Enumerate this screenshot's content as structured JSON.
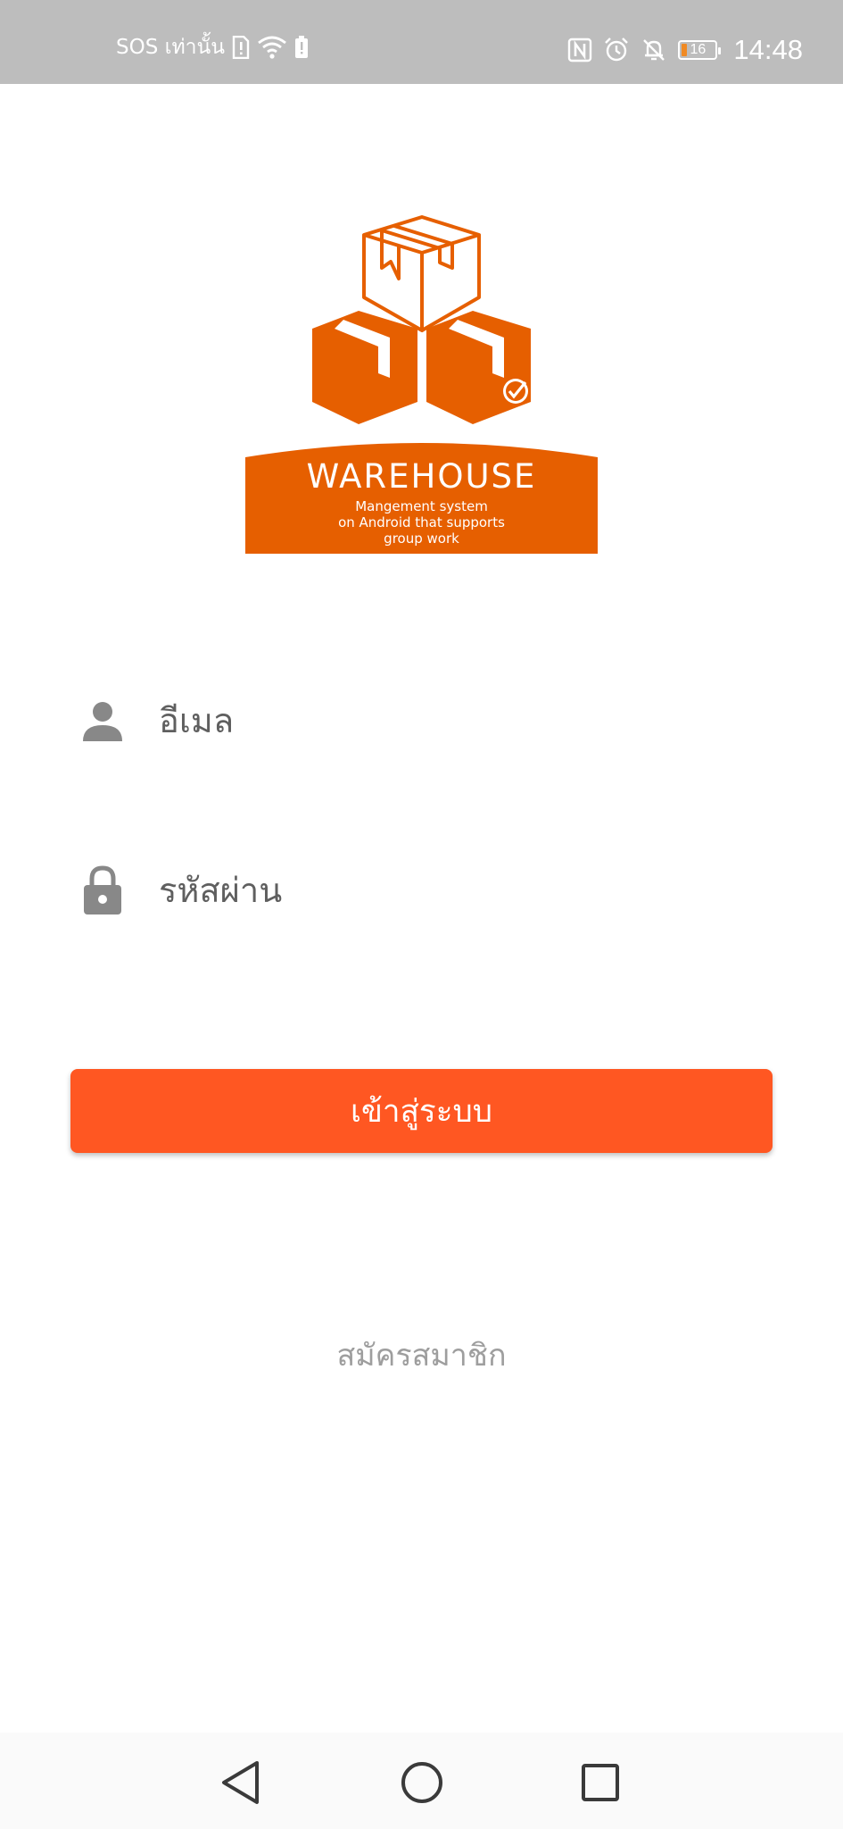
{
  "status_bar": {
    "carrier_text": "SOS เท่านั้น",
    "battery_level": "16",
    "battery_fraction": 0.16,
    "time": "14:48",
    "icons": [
      "sim-alert-icon",
      "wifi-icon",
      "battery-saver-icon",
      "nfc-icon",
      "alarm-icon",
      "bell-off-icon",
      "battery-icon"
    ]
  },
  "logo": {
    "title": "WAREHOUSE",
    "subtitle_lines": [
      "Mangement system",
      "on Android that supports",
      "group work"
    ],
    "brand_color": "#e65f00"
  },
  "form": {
    "email_placeholder": "อีเมล",
    "password_placeholder": "รหัสผ่าน",
    "email_icon": "person-icon",
    "password_icon": "lock-icon",
    "login_label": "เข้าสู่ระบบ",
    "register_label": "สมัครสมาชิก",
    "accent_color": "#ff5722"
  },
  "nav_bar": {
    "icons": [
      "back-icon",
      "home-icon",
      "recent-apps-icon"
    ]
  }
}
